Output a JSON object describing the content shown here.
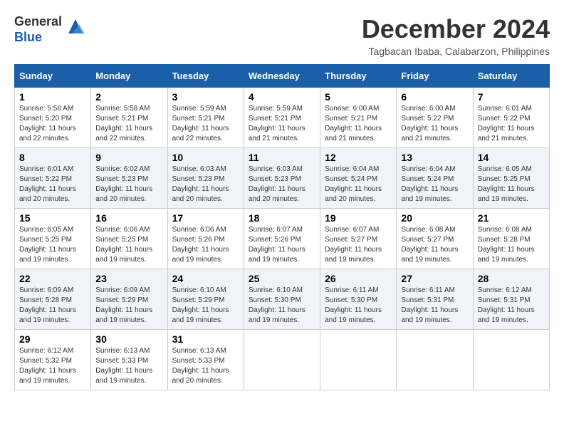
{
  "header": {
    "logo_line1": "General",
    "logo_line2": "Blue",
    "title": "December 2024",
    "location": "Tagbacan Ibaba, Calabarzon, Philippines"
  },
  "calendar": {
    "days_of_week": [
      "Sunday",
      "Monday",
      "Tuesday",
      "Wednesday",
      "Thursday",
      "Friday",
      "Saturday"
    ],
    "weeks": [
      [
        {
          "day": "1",
          "info": "Sunrise: 5:58 AM\nSunset: 5:20 PM\nDaylight: 11 hours\nand 22 minutes."
        },
        {
          "day": "2",
          "info": "Sunrise: 5:58 AM\nSunset: 5:21 PM\nDaylight: 11 hours\nand 22 minutes."
        },
        {
          "day": "3",
          "info": "Sunrise: 5:59 AM\nSunset: 5:21 PM\nDaylight: 11 hours\nand 22 minutes."
        },
        {
          "day": "4",
          "info": "Sunrise: 5:59 AM\nSunset: 5:21 PM\nDaylight: 11 hours\nand 21 minutes."
        },
        {
          "day": "5",
          "info": "Sunrise: 6:00 AM\nSunset: 5:21 PM\nDaylight: 11 hours\nand 21 minutes."
        },
        {
          "day": "6",
          "info": "Sunrise: 6:00 AM\nSunset: 5:22 PM\nDaylight: 11 hours\nand 21 minutes."
        },
        {
          "day": "7",
          "info": "Sunrise: 6:01 AM\nSunset: 5:22 PM\nDaylight: 11 hours\nand 21 minutes."
        }
      ],
      [
        {
          "day": "8",
          "info": "Sunrise: 6:01 AM\nSunset: 5:22 PM\nDaylight: 11 hours\nand 20 minutes."
        },
        {
          "day": "9",
          "info": "Sunrise: 6:02 AM\nSunset: 5:23 PM\nDaylight: 11 hours\nand 20 minutes."
        },
        {
          "day": "10",
          "info": "Sunrise: 6:03 AM\nSunset: 5:23 PM\nDaylight: 11 hours\nand 20 minutes."
        },
        {
          "day": "11",
          "info": "Sunrise: 6:03 AM\nSunset: 5:23 PM\nDaylight: 11 hours\nand 20 minutes."
        },
        {
          "day": "12",
          "info": "Sunrise: 6:04 AM\nSunset: 5:24 PM\nDaylight: 11 hours\nand 20 minutes."
        },
        {
          "day": "13",
          "info": "Sunrise: 6:04 AM\nSunset: 5:24 PM\nDaylight: 11 hours\nand 19 minutes."
        },
        {
          "day": "14",
          "info": "Sunrise: 6:05 AM\nSunset: 5:25 PM\nDaylight: 11 hours\nand 19 minutes."
        }
      ],
      [
        {
          "day": "15",
          "info": "Sunrise: 6:05 AM\nSunset: 5:25 PM\nDaylight: 11 hours\nand 19 minutes."
        },
        {
          "day": "16",
          "info": "Sunrise: 6:06 AM\nSunset: 5:25 PM\nDaylight: 11 hours\nand 19 minutes."
        },
        {
          "day": "17",
          "info": "Sunrise: 6:06 AM\nSunset: 5:26 PM\nDaylight: 11 hours\nand 19 minutes."
        },
        {
          "day": "18",
          "info": "Sunrise: 6:07 AM\nSunset: 5:26 PM\nDaylight: 11 hours\nand 19 minutes."
        },
        {
          "day": "19",
          "info": "Sunrise: 6:07 AM\nSunset: 5:27 PM\nDaylight: 11 hours\nand 19 minutes."
        },
        {
          "day": "20",
          "info": "Sunrise: 6:08 AM\nSunset: 5:27 PM\nDaylight: 11 hours\nand 19 minutes."
        },
        {
          "day": "21",
          "info": "Sunrise: 6:08 AM\nSunset: 5:28 PM\nDaylight: 11 hours\nand 19 minutes."
        }
      ],
      [
        {
          "day": "22",
          "info": "Sunrise: 6:09 AM\nSunset: 5:28 PM\nDaylight: 11 hours\nand 19 minutes."
        },
        {
          "day": "23",
          "info": "Sunrise: 6:09 AM\nSunset: 5:29 PM\nDaylight: 11 hours\nand 19 minutes."
        },
        {
          "day": "24",
          "info": "Sunrise: 6:10 AM\nSunset: 5:29 PM\nDaylight: 11 hours\nand 19 minutes."
        },
        {
          "day": "25",
          "info": "Sunrise: 6:10 AM\nSunset: 5:30 PM\nDaylight: 11 hours\nand 19 minutes."
        },
        {
          "day": "26",
          "info": "Sunrise: 6:11 AM\nSunset: 5:30 PM\nDaylight: 11 hours\nand 19 minutes."
        },
        {
          "day": "27",
          "info": "Sunrise: 6:11 AM\nSunset: 5:31 PM\nDaylight: 11 hours\nand 19 minutes."
        },
        {
          "day": "28",
          "info": "Sunrise: 6:12 AM\nSunset: 5:31 PM\nDaylight: 11 hours\nand 19 minutes."
        }
      ],
      [
        {
          "day": "29",
          "info": "Sunrise: 6:12 AM\nSunset: 5:32 PM\nDaylight: 11 hours\nand 19 minutes."
        },
        {
          "day": "30",
          "info": "Sunrise: 6:13 AM\nSunset: 5:33 PM\nDaylight: 11 hours\nand 19 minutes."
        },
        {
          "day": "31",
          "info": "Sunrise: 6:13 AM\nSunset: 5:33 PM\nDaylight: 11 hours\nand 20 minutes."
        },
        {
          "day": "",
          "info": ""
        },
        {
          "day": "",
          "info": ""
        },
        {
          "day": "",
          "info": ""
        },
        {
          "day": "",
          "info": ""
        }
      ]
    ]
  }
}
